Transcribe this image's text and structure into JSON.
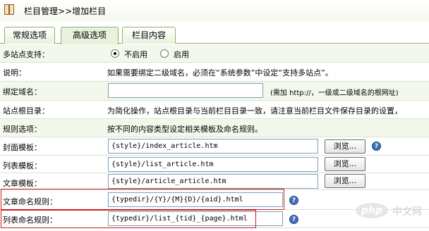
{
  "breadcrumb": {
    "section": "栏目管理",
    "arrow": ">>",
    "current": "增加栏目"
  },
  "tabs": [
    {
      "label": "常规选项"
    },
    {
      "label": "高级选项"
    },
    {
      "label": "栏目内容"
    }
  ],
  "rows": {
    "multisite": {
      "label": "多站点支持：",
      "opt_off": "不启用",
      "opt_on": "启用",
      "selected": "不启用"
    },
    "note": {
      "label": "说明：",
      "text": "如果需要绑定二级域名，必须在“系统参数”中设定“支持多站点”。"
    },
    "domain": {
      "label": "绑定域名：",
      "value": "",
      "hint": "(需加 http://，一级或二级域名的根网址)"
    },
    "siteroot": {
      "label": "站点根目录：",
      "text": "为简化操作，站点根目录与当前栏目目录一致，请注意当前栏目文件保存目录的设置，"
    },
    "rules": {
      "label": "规则选项：",
      "text": "按不同的内容类型设定相关模板及命名规则。"
    },
    "cover": {
      "label": "封面模板：",
      "value": "{style}/index_article.htm",
      "button": "浏览..."
    },
    "list": {
      "label": "列表模板：",
      "value": "{style}/list_article.htm",
      "button": "浏览..."
    },
    "article": {
      "label": "文章模板：",
      "value": "{style}/article_article.htm",
      "button": "浏览..."
    },
    "article_naming": {
      "label": "文章命名规则：",
      "value": "{typedir}/{Y}/{M}{D}/{aid}.html"
    },
    "list_naming": {
      "label": "列表命名规则：",
      "value": "{typedir}/list_{tid}_{page}.html"
    }
  },
  "help_symbol": "?",
  "watermark": {
    "logo": "php",
    "text": "中文网"
  },
  "colors": {
    "tab_border": "#8fb26a",
    "alt_row": "#f3f8ec",
    "highlight": "#d11d1d"
  }
}
